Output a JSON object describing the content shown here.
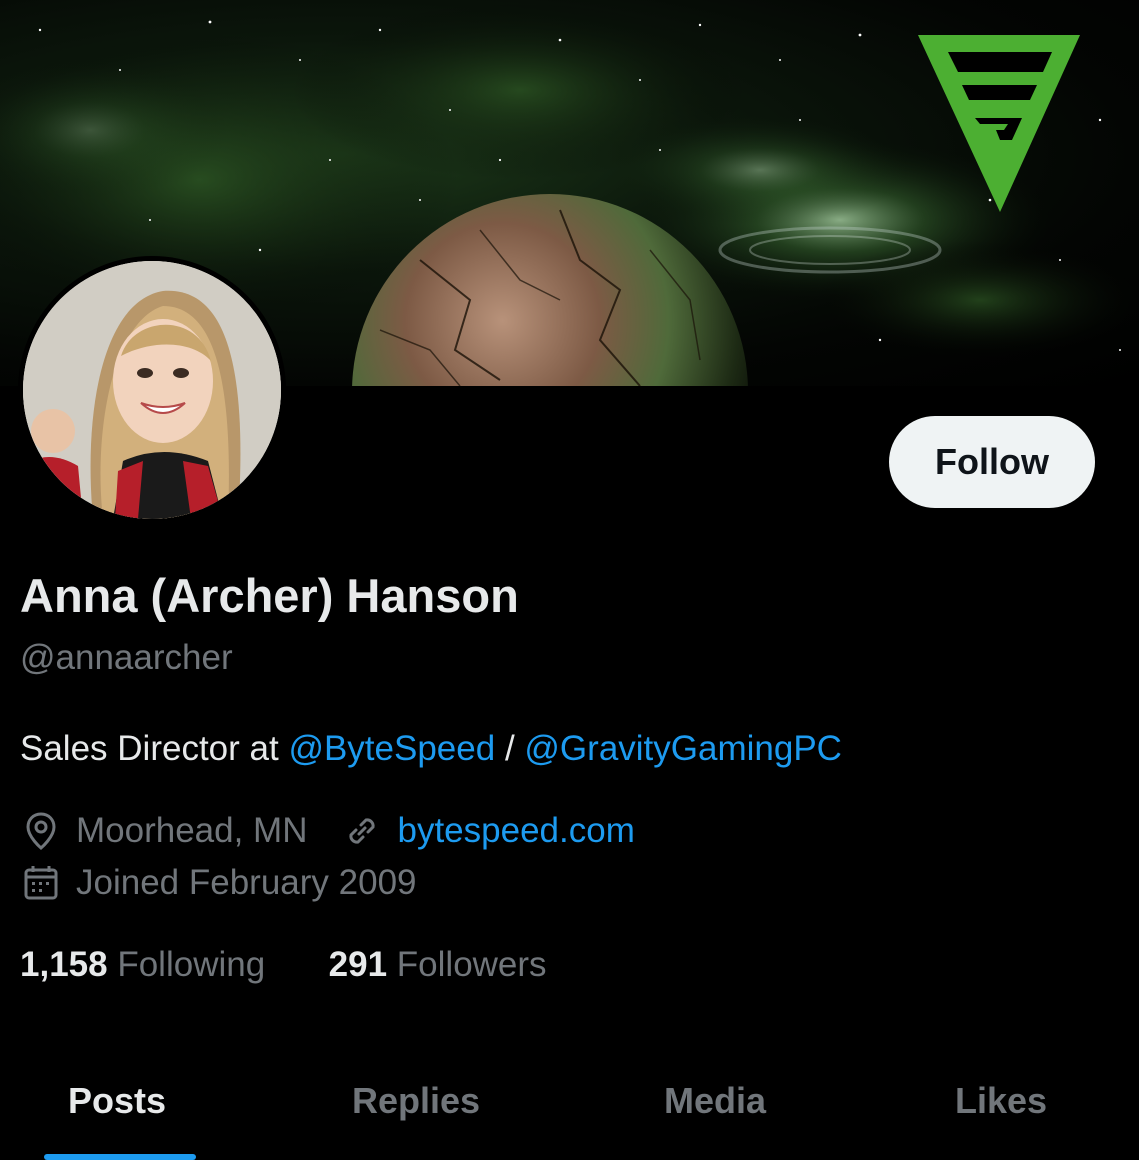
{
  "profile": {
    "display_name": "Anna (Archer) Hanson",
    "handle": "@annaarcher",
    "bio_prefix": "Sales Director at ",
    "bio_link1": "@ByteSpeed",
    "bio_sep": " / ",
    "bio_link2": "@GravityGamingPC",
    "location": "Moorhead, MN",
    "website": "bytespeed.com",
    "joined": "Joined February 2009"
  },
  "actions": {
    "follow_label": "Follow"
  },
  "stats": {
    "following_count": "1,158",
    "following_label": "Following",
    "followers_count": "291",
    "followers_label": "Followers"
  },
  "tabs": [
    {
      "label": "Posts",
      "active": true
    },
    {
      "label": "Replies",
      "active": false
    },
    {
      "label": "Media",
      "active": false
    },
    {
      "label": "Likes",
      "active": false
    }
  ],
  "colors": {
    "background": "#000000",
    "text_primary": "#e7e9ea",
    "text_secondary": "#71767b",
    "accent": "#1d9bf0",
    "logo_green": "#4caf32"
  },
  "icons": {
    "location": "location-pin-icon",
    "website": "link-icon",
    "joined": "calendar-icon"
  }
}
